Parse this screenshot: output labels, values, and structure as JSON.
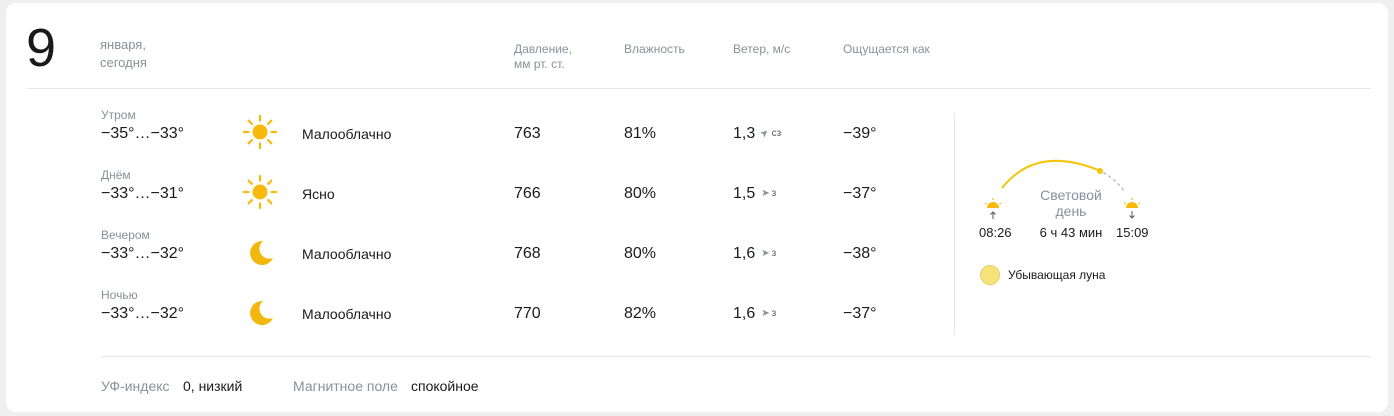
{
  "date": {
    "day": "9",
    "month": "января,",
    "relative": "сегодня"
  },
  "columns": {
    "pressure_line1": "Давление,",
    "pressure_line2": "мм рт. ст.",
    "humidity": "Влажность",
    "wind": "Ветер, м/с",
    "feels": "Ощущается как"
  },
  "rows": [
    {
      "part": "Утром",
      "temp": "−35°…−33°",
      "icon": "sun-icon",
      "condition": "Малооблачно",
      "pressure": "763",
      "humidity": "81%",
      "wind_speed": "1,3",
      "wind_dir": "СЗ",
      "feels": "−39°"
    },
    {
      "part": "Днём",
      "temp": "−33°…−31°",
      "icon": "sun-icon",
      "condition": "Ясно",
      "pressure": "766",
      "humidity": "80%",
      "wind_speed": "1,5",
      "wind_dir": "З",
      "feels": "−37°"
    },
    {
      "part": "Вечером",
      "temp": "−33°…−32°",
      "icon": "moon-icon",
      "condition": "Малооблачно",
      "pressure": "768",
      "humidity": "80%",
      "wind_speed": "1,6",
      "wind_dir": "З",
      "feels": "−38°"
    },
    {
      "part": "Ночью",
      "temp": "−33°…−32°",
      "icon": "moon-icon",
      "condition": "Малооблачно",
      "pressure": "770",
      "humidity": "82%",
      "wind_speed": "1,6",
      "wind_dir": "З",
      "feels": "−37°"
    }
  ],
  "daylight": {
    "label_line1": "Световой",
    "label_line2": "день",
    "sunrise": "08:26",
    "duration": "6 ч 43 мин",
    "sunset": "15:09",
    "moon_phase": "Убывающая луна"
  },
  "footer": {
    "uv_label": "УФ-индекс",
    "uv_value": "0, низкий",
    "magnetic_label": "Магнитное поле",
    "magnetic_value": "спокойное"
  },
  "colors": {
    "sun": "#f7b90c",
    "moon": "#f2b70e",
    "arc": "#f5c50d",
    "muted": "#8a9099"
  }
}
